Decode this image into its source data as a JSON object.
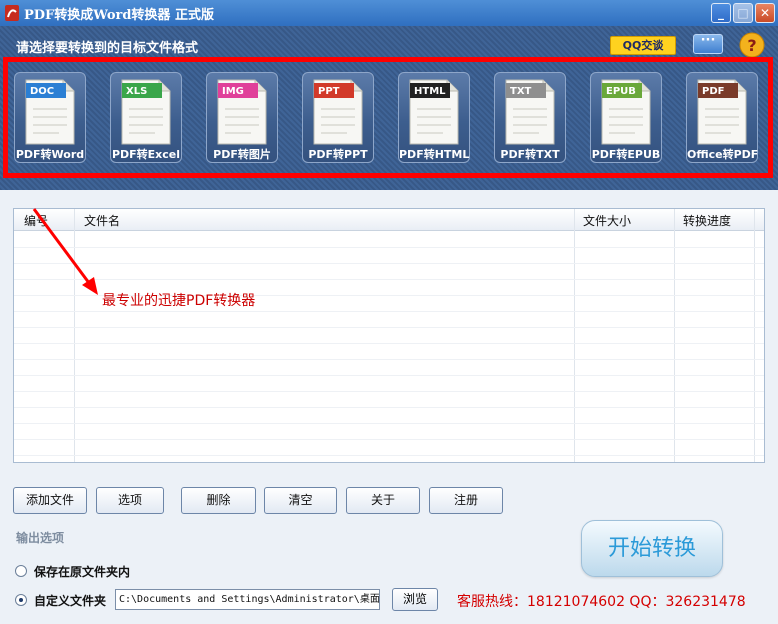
{
  "window": {
    "title": "PDF转换成Word转换器 正式版",
    "minimize_icon": "minimize-icon",
    "maximize_icon": "maximize-icon",
    "close_icon": "close-icon"
  },
  "header": {
    "label": "请选择要转换到的目标文件格式",
    "qq_button": "QQ交谈",
    "more_icon": "more-icon",
    "help_icon": "help-icon"
  },
  "formats": [
    {
      "badge": "DOC",
      "label": "PDF转Word",
      "color": "#2b7fd4"
    },
    {
      "badge": "XLS",
      "label": "PDF转Excel",
      "color": "#3aa64a"
    },
    {
      "badge": "IMG",
      "label": "PDF转图片",
      "color": "#e0409a"
    },
    {
      "badge": "PPT",
      "label": "PDF转PPT",
      "color": "#d23a2a"
    },
    {
      "badge": "HTML",
      "label": "PDF转HTML",
      "color": "#222222"
    },
    {
      "badge": "TXT",
      "label": "PDF转TXT",
      "color": "#8f8f8f"
    },
    {
      "badge": "EPUB",
      "label": "PDF转EPUB",
      "color": "#6aa83a"
    },
    {
      "badge": "PDF",
      "label": "Office转PDF",
      "color": "#7a3b2a"
    }
  ],
  "file_list": {
    "columns": [
      "编号",
      "文件名",
      "文件大小",
      "转换进度"
    ],
    "rows": []
  },
  "annotation": "最专业的迅捷PDF转换器",
  "toolbar": [
    "添加文件",
    "选项",
    "删除",
    "清空",
    "关于",
    "注册"
  ],
  "output": {
    "section_label": "输出选项",
    "option_original": "保存在原文件夹内",
    "option_custom": "自定义文件夹",
    "selected": "custom",
    "path_value": "C:\\Documents and Settings\\Administrator\\桌面",
    "browse_button": "浏览"
  },
  "start_button": "开始转换",
  "hotline": "客服热线：18121074602 QQ：326231478"
}
